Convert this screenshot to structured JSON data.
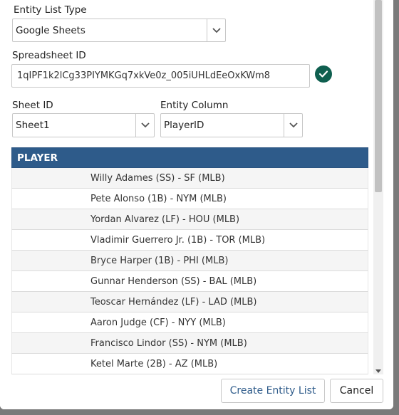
{
  "form": {
    "entity_list_type": {
      "label": "Entity List Type",
      "value": "Google Sheets"
    },
    "spreadsheet_id": {
      "label": "Spreadsheet ID",
      "value": "1qIPF1k2lCg33PIYMKGq7xkVe0z_005iUHLdEeOxKWm8",
      "status_icon": "check-circle-icon",
      "status_color": "#0f5f4f"
    },
    "sheet_id": {
      "label": "Sheet ID",
      "value": "Sheet1"
    },
    "entity_column": {
      "label": "Entity Column",
      "value": "PlayerID"
    }
  },
  "table": {
    "header": "PLAYER",
    "header_color": "#2e5b8a",
    "rows": [
      "Willy Adames (SS) - SF (MLB)",
      "Pete Alonso (1B) - NYM (MLB)",
      "Yordan Alvarez (LF) - HOU (MLB)",
      "Vladimir Guerrero Jr. (1B) - TOR (MLB)",
      "Bryce Harper (1B) - PHI (MLB)",
      "Gunnar Henderson (SS) - BAL (MLB)",
      "Teoscar Hernández (LF) - LAD (MLB)",
      "Aaron Judge (CF) - NYY (MLB)",
      "Francisco Lindor (SS) - NYM (MLB)",
      "Ketel Marte (2B) - AZ (MLB)"
    ]
  },
  "footer": {
    "create_label": "Create Entity List",
    "cancel_label": "Cancel"
  }
}
